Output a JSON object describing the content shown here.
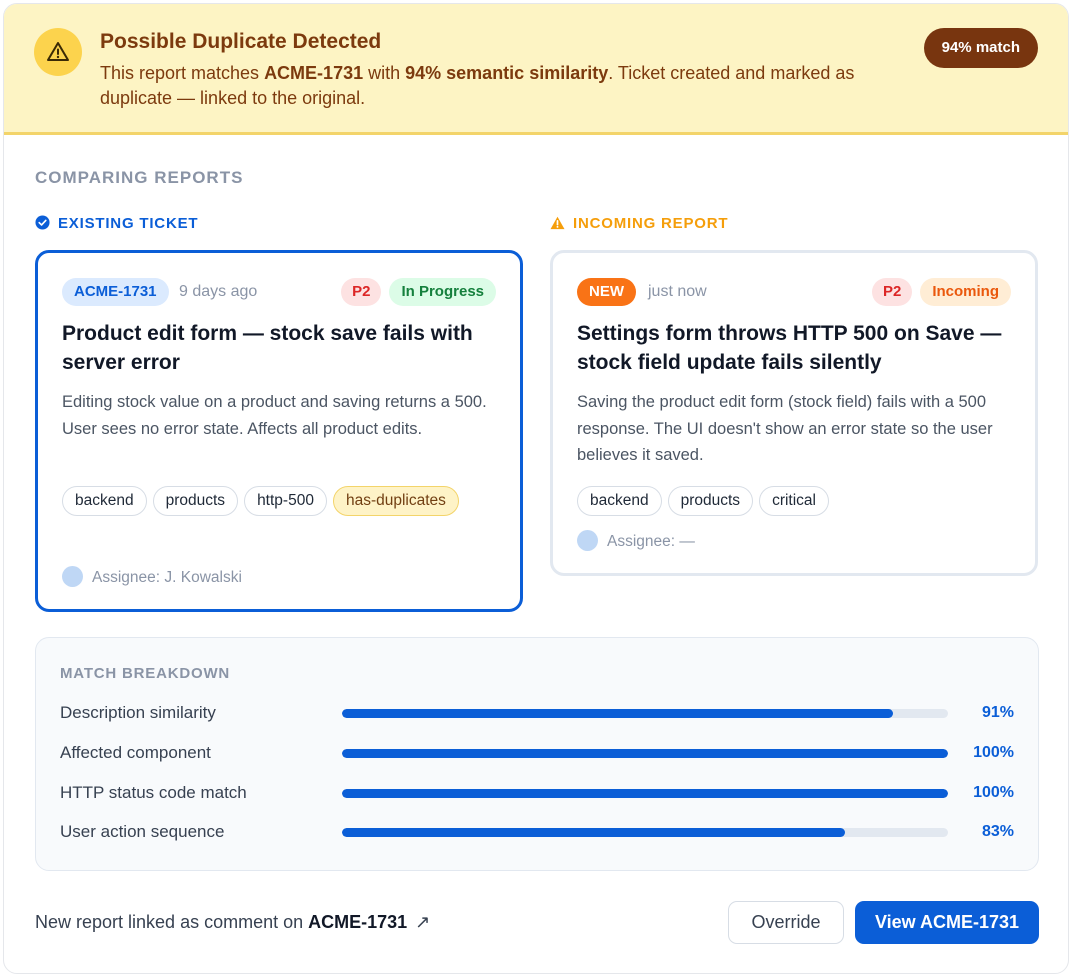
{
  "banner": {
    "title": "Possible Duplicate Detected",
    "text_pre": "This report matches ",
    "ticket_ref": "ACME-1731",
    "text_mid": " with ",
    "similarity": "94% semantic similarity",
    "text_post": ". Ticket created and marked as duplicate — linked to the original.",
    "match_pill": "94% match",
    "icon": "warning-triangle-icon",
    "color": "#fdf4c4"
  },
  "section_title": "COMPARING REPORTS",
  "existing": {
    "heading": "EXISTING TICKET",
    "heading_icon": "check-circle-icon",
    "id": "ACME-1731",
    "time": "9 days ago",
    "priority": "P2",
    "status": "In Progress",
    "title": "Product edit form — stock save fails with server error",
    "description": "Editing stock value on a product and saving returns a 500. User sees no error state. Affects all product edits.",
    "tags": [
      "backend",
      "products",
      "http-500",
      "has-duplicates"
    ],
    "assignee": "Assignee: J. Kowalski",
    "accent": "#0b5ed7"
  },
  "incoming": {
    "heading": "INCOMING REPORT",
    "heading_icon": "warning-triangle-icon",
    "badge": "NEW",
    "time": "just now",
    "priority": "P2",
    "status": "Incoming",
    "title": "Settings form throws HTTP 500 on Save — stock field update fails silently",
    "description": "Saving the product edit form (stock field) fails with a 500 response. The UI doesn't show an error state so the user believes it saved.",
    "tags": [
      "backend",
      "products",
      "critical"
    ],
    "assignee": "Assignee: —",
    "accent": "#f59e0b"
  },
  "breakdown": {
    "title": "MATCH BREAKDOWN",
    "rows": [
      {
        "label": "Description similarity",
        "value": 91,
        "display": "91%"
      },
      {
        "label": "Affected component",
        "value": 100,
        "display": "100%"
      },
      {
        "label": "HTTP status code match",
        "value": 100,
        "display": "100%"
      },
      {
        "label": "User action sequence",
        "value": 83,
        "display": "83%"
      }
    ]
  },
  "footer": {
    "text": "New report linked as comment on ",
    "ticket": "ACME-1731",
    "link_icon": "external-link-arrow-icon",
    "override_label": "Override",
    "view_label": "View ACME-1731"
  }
}
